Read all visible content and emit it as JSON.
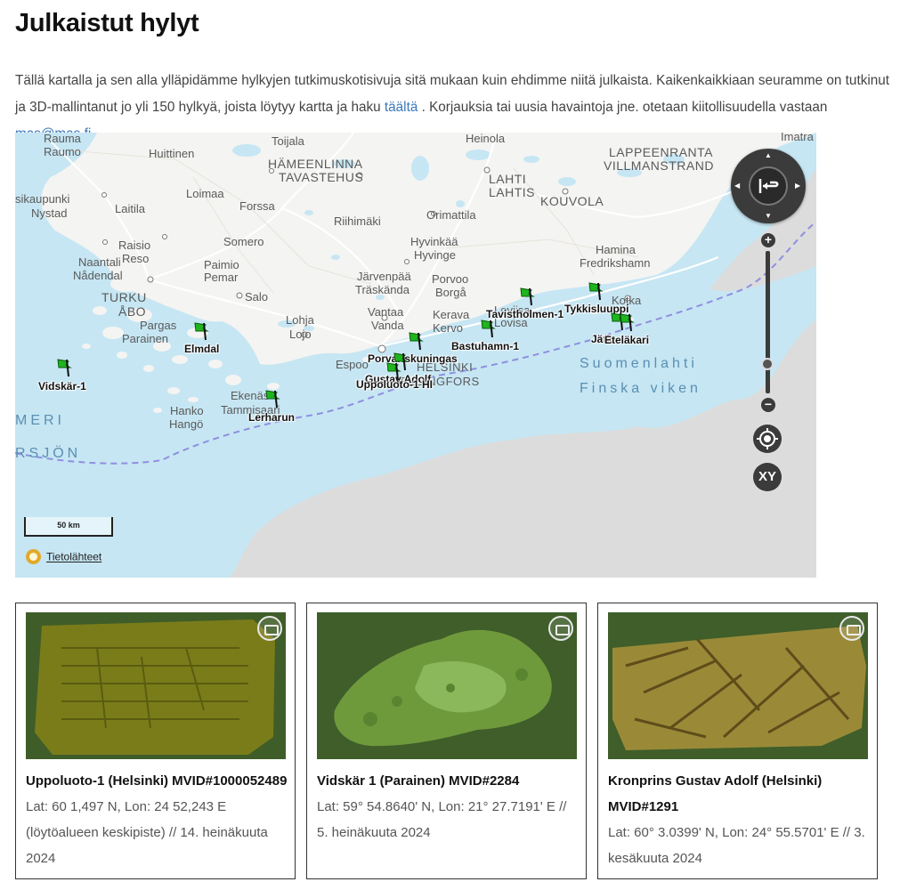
{
  "page_title": "Julkaistut hylyt",
  "intro": {
    "text_before_link": "Tällä kartalla ja sen alla ylläpidämme hylkyjen tutkimuskotisivuja sitä mukaan kuin ehdimme niitä julkaista. Kaikenkaikkiaan seuramme on tutkinut ja 3D-mallintanut jo yli 150 hylkyä, joista löytyy kartta ja haku ",
    "link_text": "täältä",
    "text_after_link": " . Korjauksia tai uusia havaintoja jne. otetaan kiitollisuudella vastaan ",
    "email": "mas@mas.fi"
  },
  "map": {
    "colors": {
      "sea": "#c6e6f3",
      "land": "#f4f4f2",
      "foreign_land": "#dddddd",
      "road": "#ffffff",
      "flag": "#1eb51e",
      "border_line": "#8f8fe0"
    },
    "place_names": [
      "Rauma",
      "Raumo",
      "Huittinen",
      "Toijala",
      "HÄMEENLINNA",
      "TAVASTEHUS",
      "Heinola",
      "LAHTI",
      "LAHTIS",
      "LAPPEENRANTA",
      "VILLMANSTRAND",
      "Imatra",
      "sikaupunki",
      "Nystad",
      "Laitila",
      "Loimaa",
      "Forssa",
      "Riihimäki",
      "Orimattila",
      "KOUVOLA",
      "Raisio",
      "Reso",
      "Naantali",
      "Nådendal",
      "Somero",
      "Paimio",
      "Pemar",
      "Hyvinkää",
      "Hyvinge",
      "Hamina",
      "Fredrikshamn",
      "TURKU",
      "ÅBO",
      "Salo",
      "Järvenpää",
      "Träskända",
      "Porvoo",
      "Borgå",
      "Kotka",
      "Pargas",
      "Parainen",
      "Lohja",
      "Lojo",
      "Vantaa",
      "Vanda",
      "Kerava",
      "Kervo",
      "Loviisa",
      "Lovisa",
      "Espoo",
      "HELSINKI",
      "HELSINGFORS",
      "Ekenäs",
      "Tammisaari",
      "Hanko",
      "Hangö",
      "Suomenlahti",
      "Finska viken",
      "MERI",
      "RSJÖN"
    ],
    "scale_label": "50 km",
    "sources_label": "Tietolähteet",
    "xy_label": "XY",
    "markers": [
      {
        "name": "Vidskär-1"
      },
      {
        "name": "Elmdal"
      },
      {
        "name": "Lerharun"
      },
      {
        "name": "Porvariskuningas"
      },
      {
        "name": "Gustav Adolf"
      },
      {
        "name": "Uppoluoto-1 HI"
      },
      {
        "name": "Bastuhamn-1"
      },
      {
        "name": "Tavistholmen-1"
      },
      {
        "name": "Tykkisluuppi"
      },
      {
        "name": "Jätk"
      },
      {
        "name": "Eteläkari"
      }
    ]
  },
  "cards": [
    {
      "title": "Uppoluoto-1 (Helsinki) MVID#1000052489",
      "meta": "Lat: 60 1,497 N, Lon: 24 52,243 E (löytöalueen keskipiste) // 14. heinäkuuta 2024"
    },
    {
      "title": "Vidskär 1 (Parainen) MVID#2284",
      "meta": "Lat: 59° 54.8640' N, Lon: 21° 27.7191' E // 5. heinäkuuta 2024"
    },
    {
      "title": "Kronprins Gustav Adolf (Helsinki) MVID#1291",
      "meta": "Lat: 60° 3.0399' N, Lon: 24° 55.5701' E // 3. kesäkuuta 2024"
    }
  ]
}
